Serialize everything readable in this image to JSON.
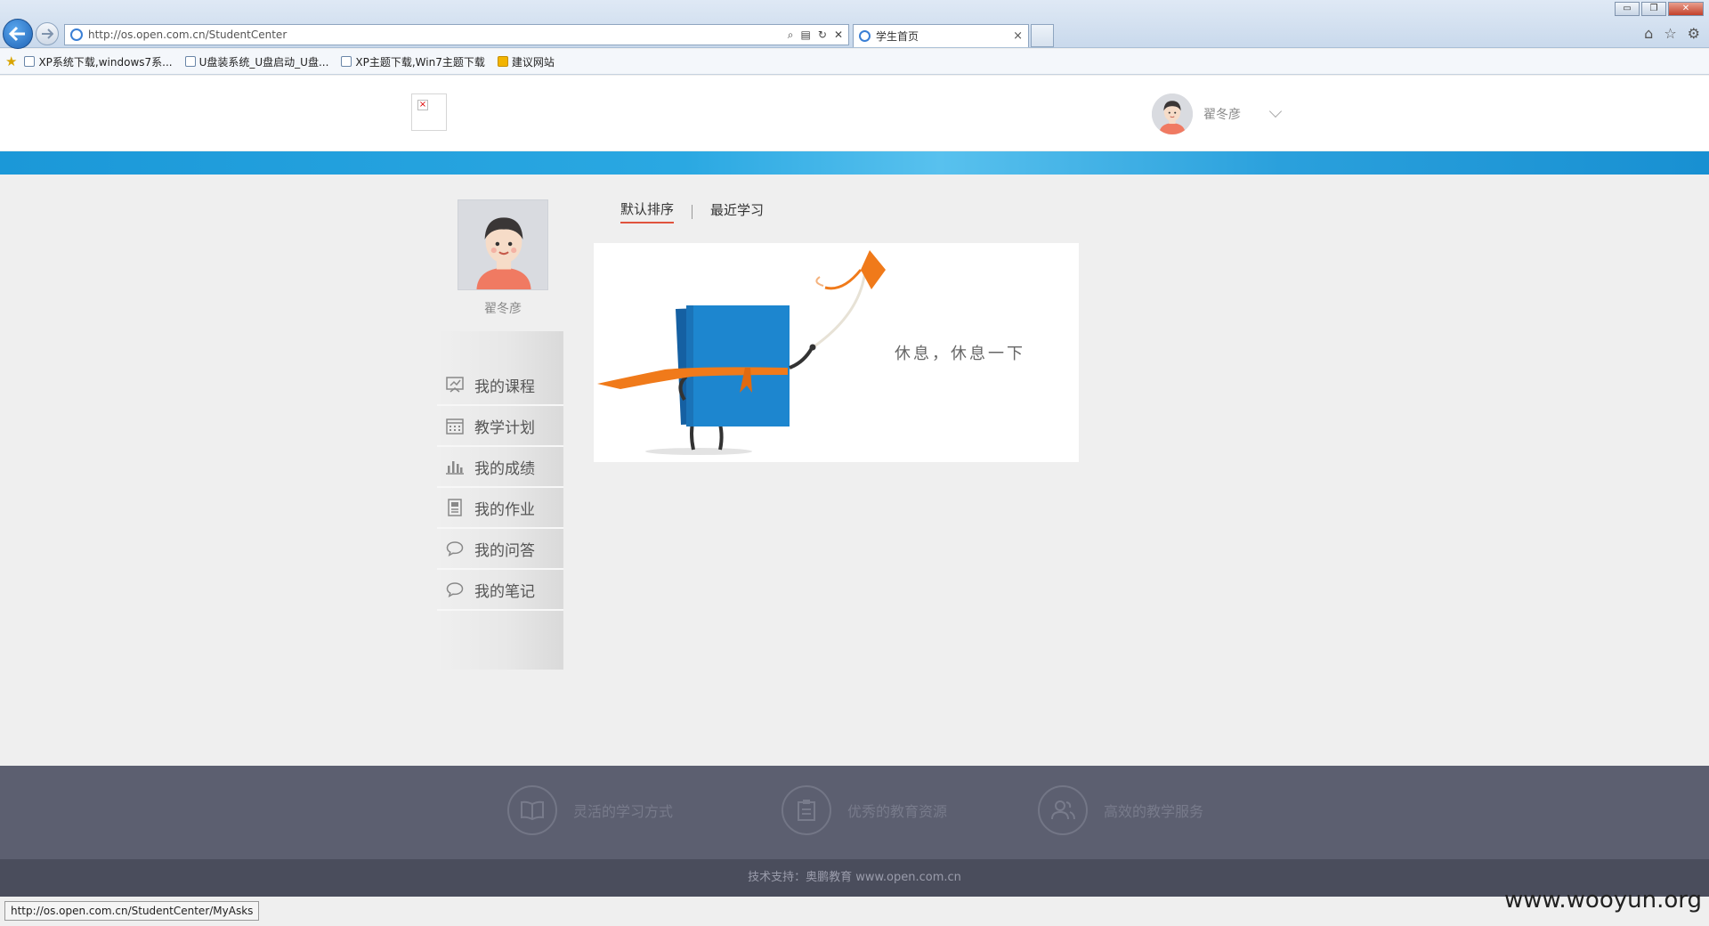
{
  "browser": {
    "url": "http://os.open.com.cn/StudentCenter",
    "tab_title": "学生首页",
    "tab_close": "×",
    "window_controls": [
      "▭",
      "❐",
      "✕"
    ],
    "favorites": [
      "XP系统下载,windows7系...",
      "U盘装系统_U盘启动_U盘...",
      "XP主题下载,Win7主题下载",
      "建议网站"
    ],
    "status_url": "http://os.open.com.cn/StudentCenter/MyAsks"
  },
  "header": {
    "user_name": "翟冬彦"
  },
  "profile": {
    "name": "翟冬彦"
  },
  "sidebar": {
    "items": [
      {
        "label": "我的课程",
        "icon": "course-icon"
      },
      {
        "label": "教学计划",
        "icon": "calendar-icon"
      },
      {
        "label": "我的成绩",
        "icon": "bar-chart-icon"
      },
      {
        "label": "我的作业",
        "icon": "homework-icon"
      },
      {
        "label": "我的问答",
        "icon": "chat-bubble-icon"
      },
      {
        "label": "我的笔记",
        "icon": "chat-bubble-icon"
      }
    ]
  },
  "main": {
    "sort_tabs": [
      {
        "label": "默认排序",
        "active": true
      },
      {
        "label": "最近学习",
        "active": false
      }
    ],
    "empty_message": "休息，休息一下"
  },
  "footer": {
    "features": [
      {
        "label": "灵活的学习方式",
        "icon": "book-icon"
      },
      {
        "label": "优秀的教育资源",
        "icon": "clipboard-icon"
      },
      {
        "label": "高效的教学服务",
        "icon": "users-icon"
      }
    ],
    "support_text": "技术支持：奥鹏教育 www.open.com.cn"
  },
  "watermark": "www.wooyun.org",
  "colors": {
    "banner": "#2aa8e2",
    "accent_underline": "#e0533d",
    "footer": "#5c5f70",
    "footer_bottom": "#4a4d5c",
    "book_blue": "#1d86cf",
    "scarf_orange": "#f07a1a"
  }
}
